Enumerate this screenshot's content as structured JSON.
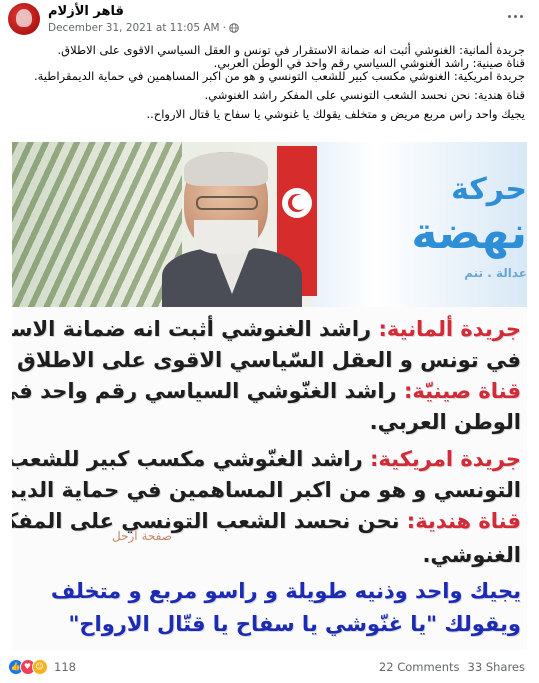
{
  "post": {
    "author": "قاهر الأزلام",
    "date": "December 31, 2021 at 11:05 AM",
    "date_separator": "·",
    "audience_icon": "globe-icon",
    "more_icon": "more-options-icon",
    "text_lines": [
      "جريدة ألمانية: الغنوشي أثبت انه ضمانة الاستقرار في تونس و العقل السياسي الاقوى على الاطلاق.",
      "قناة صينية: راشد الغنوشي السياسي رقم واحد في الوطن العربي.",
      "جريدة امريكية: الغنوشي مكسب كبير للشعب التونسي و هو من اكبر المساهمين في حماية الديمقراطية.",
      "قناة هندية: نحن نحسد الشعب التونسي على المفكر راشد الغنوشي.",
      "يجيك واحد راس مربع  مريض و متخلف يقولك يا غنوشي يا سفاح يا قتال الارواح.."
    ]
  },
  "photo": {
    "banner_line1": "حركة",
    "banner_line2": "نهضة",
    "banner_line3": "عدالة . تنم"
  },
  "image_text": {
    "l1_label": "جريدة ألمانية:",
    "l1_rest": " راشد الغنوشي أثبت انه ضمانة الاستقرار",
    "l2": "في تونس و العقل السّياسي الاقوى على الاطلاق",
    "l3_label": "قناة صينيّة:",
    "l3_rest": " راشد الغنّوشي السياسي رقم واحد في",
    "l4": "الوطن العربي.",
    "l5_label": "جريدة امريكية:",
    "l5_rest": " راشد الغنّوشي مكسب كبير للشعب",
    "l6": "التونسي و هو من اكبر المساهمين في حماية الديمقراطية",
    "l7_label": "قناة هندية:",
    "l7_rest": " نحن نحسد الشعب التونسي على المفكر راشد",
    "l8": "الغنوشي.",
    "l9": "يجيك واحد وذنيه طويلة و راسو مربع و متخلف",
    "l10": "ويقولك \"يا غنّوشي يا سفاح يا قتّال الارواح\"",
    "watermark": "صفحة ارحل"
  },
  "footer": {
    "reaction_icons": [
      "like-icon",
      "love-icon",
      "haha-icon"
    ],
    "reaction_count": "118",
    "comments": "22 Comments",
    "shares": "33 Shares"
  }
}
